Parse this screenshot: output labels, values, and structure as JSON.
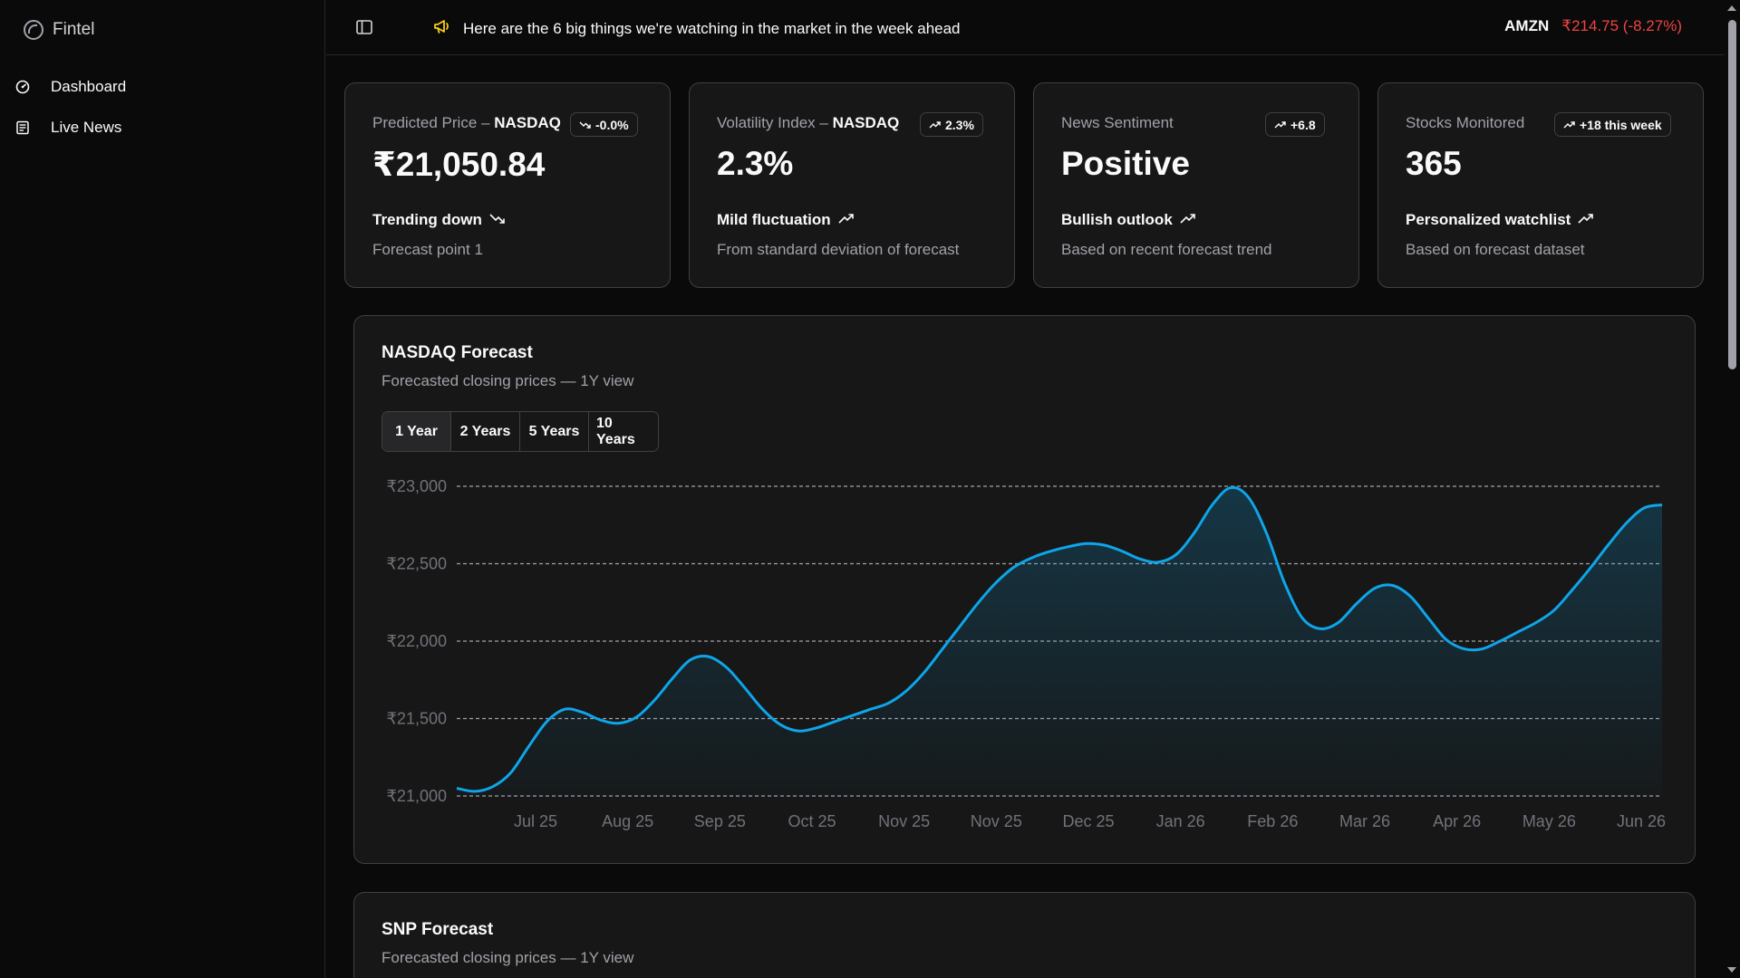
{
  "app": {
    "name": "Fintel"
  },
  "sidebar": {
    "items": [
      {
        "label": "Dashboard",
        "icon": "dashboard-icon"
      },
      {
        "label": "Live News",
        "icon": "newspaper-icon"
      }
    ]
  },
  "topbar": {
    "announcement": "Here are the 6 big things we're watching in the market in the week ahead",
    "ticker_symbol": "AMZN",
    "ticker_price": "₹214.75 (-8.27%)",
    "ticker_color": "#ef4444"
  },
  "cards": [
    {
      "title": "Predicted Price – ",
      "title_bold": "NASDAQ",
      "badge": "-0.0%",
      "badge_icon": "trending-down-icon",
      "value": "₹21,050.84",
      "trend": "Trending down",
      "trend_icon": "trending-down-icon",
      "sub": "Forecast point 1"
    },
    {
      "title": "Volatility Index – ",
      "title_bold": "NASDAQ",
      "badge": "2.3%",
      "badge_icon": "trending-up-icon",
      "value": "2.3%",
      "trend": "Mild fluctuation",
      "trend_icon": "trending-up-icon",
      "sub": "From standard deviation of forecast"
    },
    {
      "title": "News Sentiment",
      "title_bold": "",
      "badge": "+6.8",
      "badge_icon": "trending-up-icon",
      "value": "Positive",
      "trend": "Bullish outlook",
      "trend_icon": "trending-up-icon",
      "sub": "Based on recent forecast trend"
    },
    {
      "title": "Stocks Monitored",
      "title_bold": "",
      "badge": "+18 this week",
      "badge_icon": "trending-up-icon",
      "value": "365",
      "trend": "Personalized watchlist",
      "trend_icon": "trending-up-icon",
      "sub": "Based on forecast dataset"
    }
  ],
  "nasdaq_panel": {
    "title": "NASDAQ Forecast",
    "subtitle": "Forecasted closing prices — 1Y view",
    "ranges": [
      "1 Year",
      "2 Years",
      "5 Years",
      "10 Years"
    ],
    "active_range": "1 Year"
  },
  "snp_panel": {
    "title": "SNP Forecast",
    "subtitle": "Forecasted closing prices — 1Y view"
  },
  "chart_data": {
    "type": "area",
    "title": "NASDAQ Forecast",
    "xlabel": "",
    "ylabel": "",
    "ylim": [
      21000,
      23000
    ],
    "y_ticks": [
      "₹21,000",
      "₹21,500",
      "₹22,000",
      "₹22,500",
      "₹23,000"
    ],
    "y_tick_values": [
      21000,
      21500,
      22000,
      22500,
      23000
    ],
    "x_tick_labels": [
      "Jul 25",
      "Aug 25",
      "Sep 25",
      "Oct 25",
      "Nov 25",
      "Nov 25",
      "Dec 25",
      "Jan 26",
      "Feb 26",
      "Mar 26",
      "Apr 26",
      "May 26",
      "Jun 26"
    ],
    "grid": true,
    "line_color": "#0ea5e9",
    "series": [
      {
        "values": [
          21050,
          21030,
          21060,
          21150,
          21320,
          21480,
          21560,
          21540,
          21490,
          21470,
          21510,
          21620,
          21760,
          21880,
          21900,
          21830,
          21700,
          21560,
          21460,
          21420,
          21440,
          21480,
          21520,
          21560,
          21600,
          21680,
          21800,
          21950,
          22100,
          22250,
          22380,
          22480,
          22540,
          22580,
          22610,
          22630,
          22620,
          22580,
          22530,
          22510,
          22560,
          22700,
          22880,
          22990,
          22930,
          22700,
          22380,
          22150,
          22080,
          22120,
          22240,
          22340,
          22360,
          22290,
          22150,
          22010,
          21950,
          21950,
          22000,
          22060,
          22120,
          22200,
          22330,
          22470,
          22620,
          22760,
          22860,
          22880
        ]
      }
    ]
  }
}
